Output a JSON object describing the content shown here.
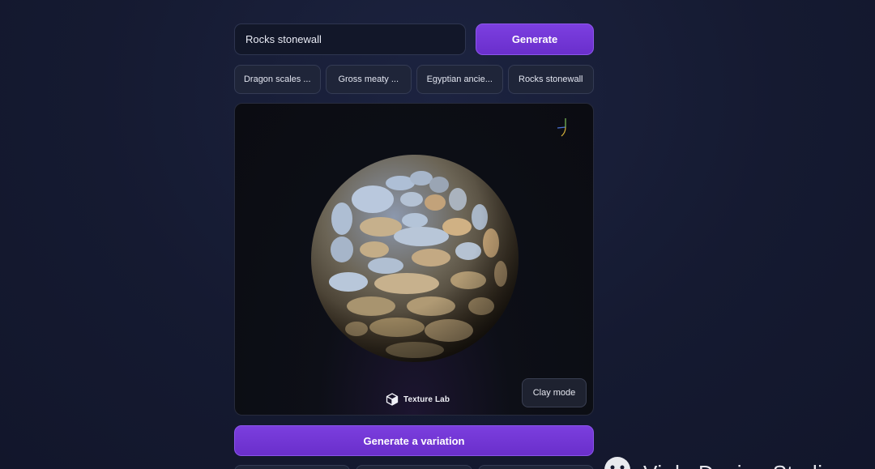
{
  "prompt": {
    "value": "Rocks stonewall"
  },
  "generate_label": "Generate",
  "suggestions": [
    "Dragon scales ...",
    "Gross meaty ...",
    "Egyptian ancie...",
    "Rocks stonewall"
  ],
  "viewer": {
    "brand": "Texture Lab",
    "clay_mode_label": "Clay mode"
  },
  "variation_label": "Generate a variation",
  "watermark": {
    "text": "Vi..le Design Studio",
    "icon": "smiley-face-icon"
  },
  "colors": {
    "accent": "#7c3fe0",
    "background": "#151a31",
    "panel": "#0b0c12"
  }
}
